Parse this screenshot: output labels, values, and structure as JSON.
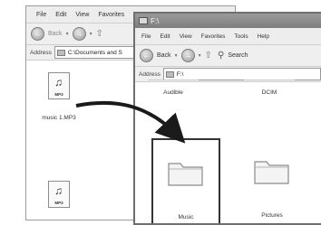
{
  "back_window": {
    "title": "",
    "menu": [
      "File",
      "Edit",
      "View",
      "Favorites"
    ],
    "toolbar": {
      "back_label": "Back"
    },
    "address": {
      "label": "Address",
      "path": "C:\\Documents and S"
    },
    "files": [
      {
        "name": "music 1.MP3",
        "type_tag": "MP3"
      },
      {
        "name": "",
        "type_tag": "MP3"
      }
    ]
  },
  "front_window": {
    "title": "F:\\",
    "menu": [
      "File",
      "Edit",
      "View",
      "Favorites",
      "Tools",
      "Help"
    ],
    "toolbar": {
      "back_label": "Back",
      "search_label": "Search"
    },
    "address": {
      "label": "Address",
      "path": "F:\\"
    },
    "folders": [
      {
        "name": "Audible"
      },
      {
        "name": "DCIM"
      },
      {
        "name": "Music"
      },
      {
        "name": "Pictures"
      }
    ]
  },
  "colors": {
    "arrow": "#1a1a1a",
    "title_bar": "#8c8c8c",
    "chrome": "#ededed"
  }
}
